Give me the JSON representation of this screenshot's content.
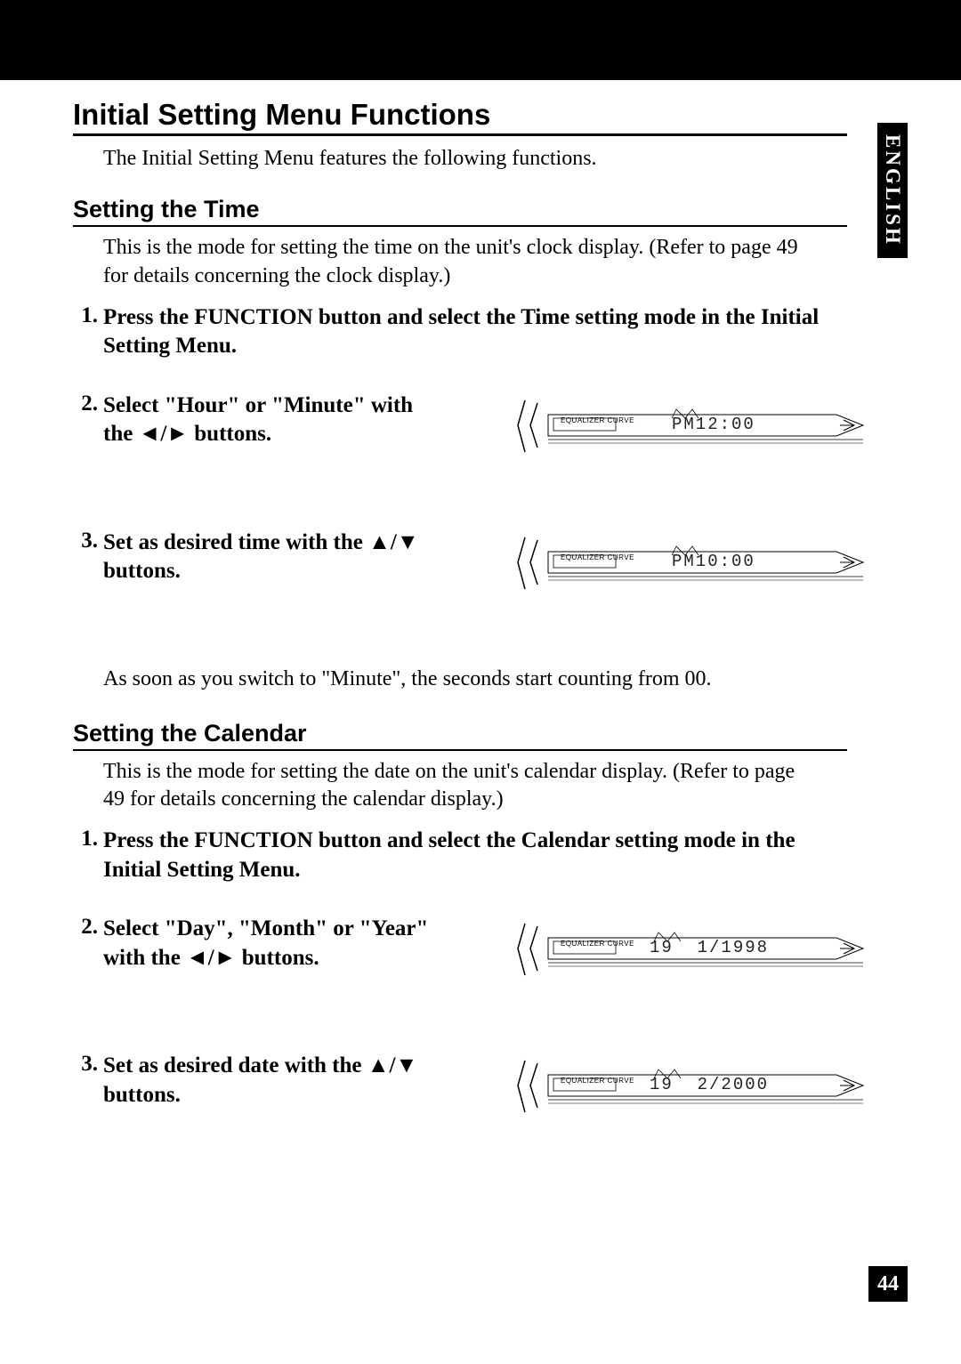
{
  "side_tab": "ENGLISH",
  "page_number": "44",
  "h1": "Initial Setting Menu Functions",
  "intro": "The Initial Setting Menu features the following functions.",
  "time": {
    "heading": "Setting the Time",
    "body": "This is the mode for setting the time on the unit's clock display. (Refer to page 49 for details concerning the clock display.)",
    "step1_num": "1.",
    "step1": "Press the FUNCTION button and select the Time setting mode in the Initial Setting Menu.",
    "step2_num": "2.",
    "step2_pre": "Select \"Hour\" or \"Minute\" with the ",
    "step2_arrows": "◄/►",
    "step2_post": " buttons.",
    "lcd2_eq": "EQUALIZER CURVE",
    "lcd2": "PM12:00",
    "step3_num": "3.",
    "step3_pre": "Set as desired time with the ",
    "step3_arrows": "▲/▼",
    "step3_post": " buttons.",
    "lcd3_eq": "EQUALIZER CURVE",
    "lcd3": "PM10:00",
    "note": "As soon as you switch to \"Minute\", the seconds start counting from 00."
  },
  "calendar": {
    "heading": "Setting the Calendar",
    "body": "This is the mode for setting the date on the unit's calendar display. (Refer to page 49 for details concerning the calendar display.)",
    "step1_num": "1.",
    "step1": "Press the FUNCTION button and select the Calendar setting mode in the Initial Setting Menu.",
    "step2_num": "2.",
    "step2_pre": "Select \"Day\", \"Month\" or \"Year\" with the ",
    "step2_arrows": "◄/►",
    "step2_post": " buttons.",
    "lcd2_eq": "EQUALIZER CURVE",
    "lcd2": "19  1/1998",
    "step3_num": "3.",
    "step3_pre": "Set as desired date with the ",
    "step3_arrows": "▲/▼",
    "step3_post": " buttons.",
    "lcd3_eq": "EQUALIZER CURVE",
    "lcd3": "19  2/2000"
  }
}
